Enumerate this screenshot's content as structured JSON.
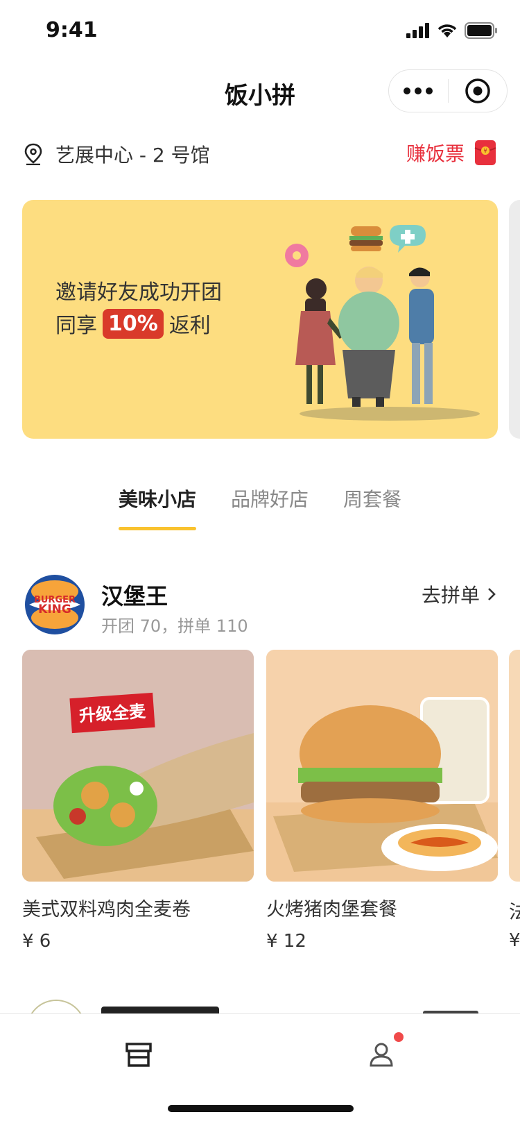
{
  "status_bar": {
    "time": "9:41"
  },
  "nav": {
    "title": "饭小拼"
  },
  "location": {
    "text": "艺展中心 - 2 号馆",
    "earn_label": "赚饭票"
  },
  "banner": {
    "line1": "邀请好友成功开团",
    "line2_prefix": "同享",
    "badge": "10%",
    "line2_suffix": "返利"
  },
  "tabs": [
    {
      "label": "美味小店",
      "active": true
    },
    {
      "label": "品牌好店",
      "active": false
    },
    {
      "label": "周套餐",
      "active": false
    }
  ],
  "store": {
    "name": "汉堡王",
    "logo_text_1": "BURGER",
    "logo_text_2": "KING",
    "stats": "开团 70，拼单 110",
    "action": "去拼单",
    "products": [
      {
        "name": "美式双料鸡肉全麦卷",
        "price": "¥ 6",
        "tag": "升级全麦"
      },
      {
        "name": "火烤猪肉堡套餐",
        "price": "¥ 12"
      }
    ],
    "peek_name": "法",
    "peek_price": "¥"
  },
  "tabbar": {
    "items": [
      {
        "icon": "store-icon"
      },
      {
        "icon": "user-icon",
        "badge": true
      }
    ]
  },
  "colors": {
    "accent": "#f9c22e",
    "red": "#e8303d",
    "banner": "#fddd80"
  }
}
